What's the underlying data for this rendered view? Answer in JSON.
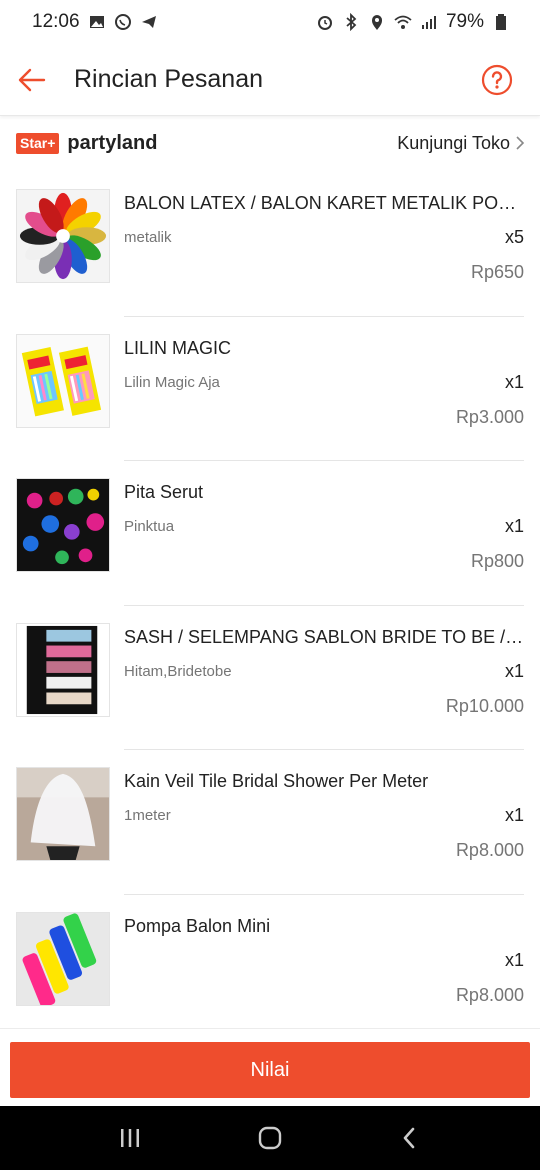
{
  "status_bar": {
    "time": "12:06",
    "battery": "79%"
  },
  "header": {
    "title": "Rincian Pesanan"
  },
  "shop": {
    "badge": "Star+",
    "name": "partyland",
    "visit_label": "Kunjungi Toko"
  },
  "items": [
    {
      "name": "BALON LATEX / BALON KARET METALIK POLK...",
      "variant": "metalik",
      "qty": "x5",
      "price": "Rp650",
      "image": "balloon-photo"
    },
    {
      "name": "LILIN MAGIC",
      "variant": "Lilin Magic Aja",
      "qty": "x1",
      "price": "Rp3.000",
      "image": "candle-photo"
    },
    {
      "name": "Pita Serut",
      "variant": "Pinktua",
      "qty": "x1",
      "price": "Rp800",
      "image": "ribbon-photo"
    },
    {
      "name": "SASH / SELEMPANG SABLON BRIDE TO BE / G...",
      "variant": "Hitam,Bridetobe",
      "qty": "x1",
      "price": "Rp10.000",
      "image": "sash-photo"
    },
    {
      "name": "Kain Veil Tile Bridal Shower Per Meter",
      "variant": "1meter",
      "qty": "x1",
      "price": "Rp8.000",
      "image": "veil-photo"
    },
    {
      "name": "Pompa Balon Mini",
      "variant": "",
      "qty": "x1",
      "price": "Rp8.000",
      "image": "pump-photo"
    }
  ],
  "bottom": {
    "rate_label": "Nilai"
  },
  "colors": {
    "accent": "#ee4d2d"
  }
}
